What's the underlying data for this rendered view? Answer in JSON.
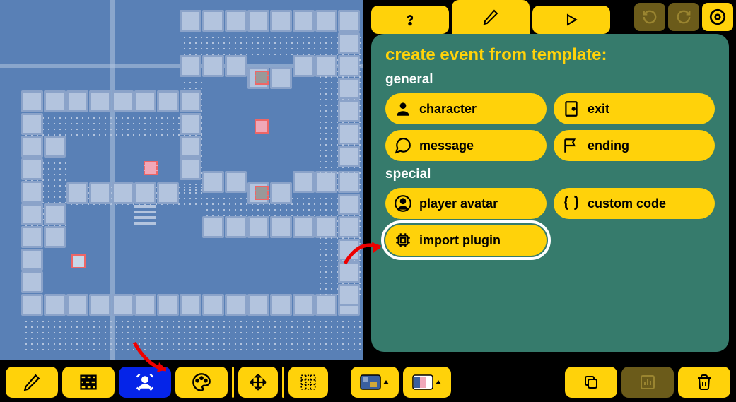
{
  "panel": {
    "title": "create event from template:",
    "sections": {
      "general": {
        "label": "general",
        "buttons": {
          "character": "character",
          "exit": "exit",
          "message": "message",
          "ending": "ending"
        }
      },
      "special": {
        "label": "special",
        "buttons": {
          "player_avatar": "player avatar",
          "custom_code": "custom code",
          "import_plugin": "import plugin"
        }
      }
    }
  },
  "tabs": {
    "help": "?",
    "edit": "edit",
    "play": "play"
  },
  "toolbar": {
    "draw": "draw",
    "tiles": "tiles",
    "events": "events",
    "palette": "palette",
    "move": "move",
    "grid": "grid",
    "room_picker": "room",
    "colors_picker": "colors",
    "copy": "copy",
    "stats": "stats",
    "delete": "delete"
  },
  "colors": {
    "accent": "#ffd20a",
    "panel": "#367b6c",
    "map_bg": "#5980b6",
    "active_tool": "#0524e8"
  }
}
